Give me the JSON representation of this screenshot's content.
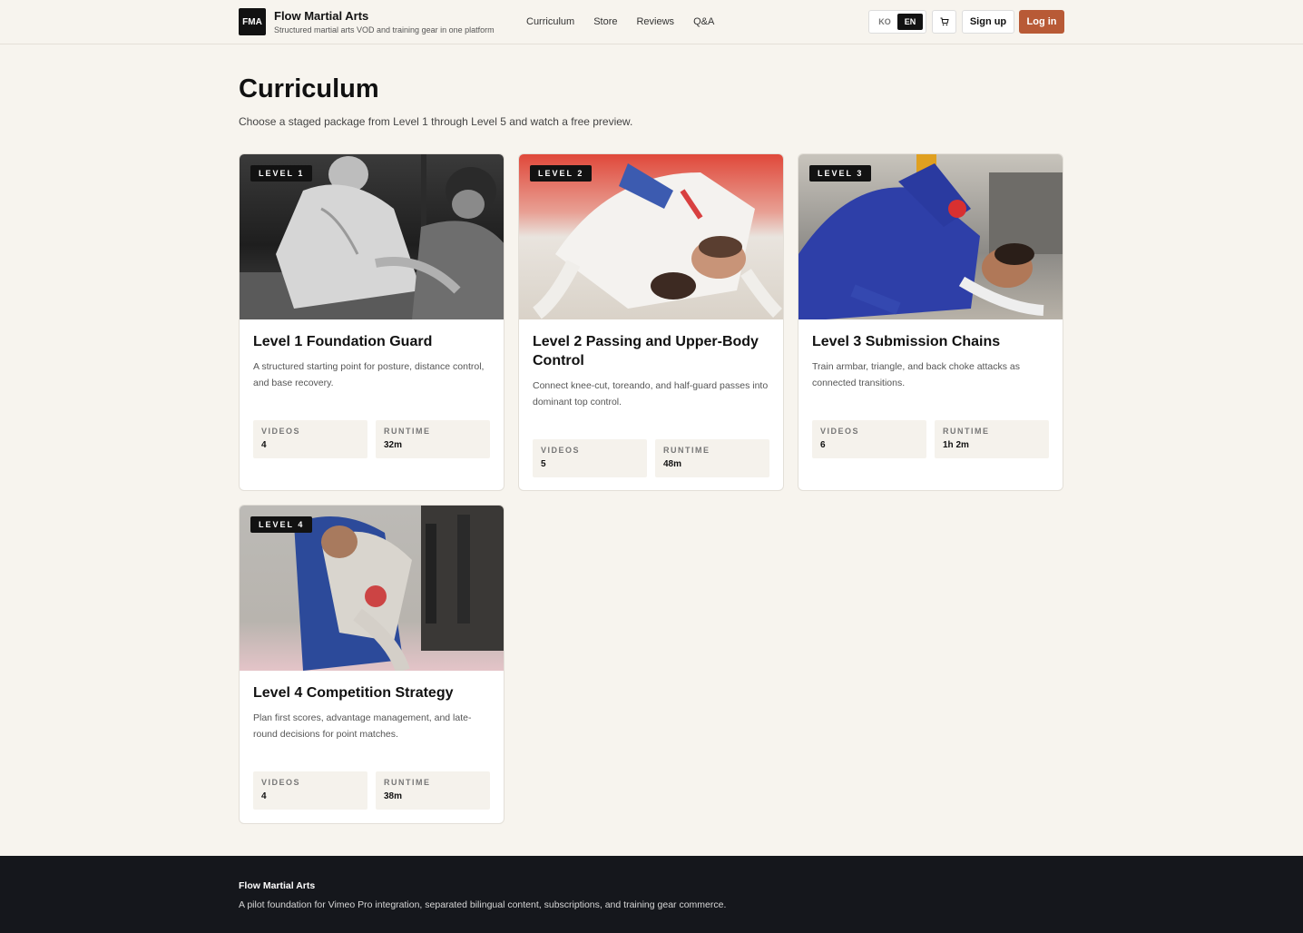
{
  "header": {
    "logo": "FMA",
    "brand_title": "Flow Martial Arts",
    "brand_subtitle": "Structured martial arts VOD and training gear in one platform",
    "nav": [
      "Curriculum",
      "Store",
      "Reviews",
      "Q&A"
    ],
    "lang_ko": "KO",
    "lang_en": "EN",
    "cart_icon": "cart-icon",
    "signup": "Sign up",
    "login": "Log in"
  },
  "main": {
    "title": "Curriculum",
    "subtitle": "Choose a staged package from Level 1 through Level 5 and watch a free preview."
  },
  "cards": [
    {
      "badge": "LEVEL 1",
      "title": "Level 1 Foundation Guard",
      "desc": "A structured starting point for posture, distance control, and base recovery.",
      "videos_label": "VIDEOS",
      "videos": "4",
      "runtime_label": "RUNTIME",
      "runtime": "32m"
    },
    {
      "badge": "LEVEL 2",
      "title": "Level 2 Passing and Upper-Body Control",
      "desc": "Connect knee-cut, toreando, and half-guard passes into dominant top control.",
      "videos_label": "VIDEOS",
      "videos": "5",
      "runtime_label": "RUNTIME",
      "runtime": "48m"
    },
    {
      "badge": "LEVEL 3",
      "title": "Level 3 Submission Chains",
      "desc": "Train armbar, triangle, and back choke attacks as connected transitions.",
      "videos_label": "VIDEOS",
      "videos": "6",
      "runtime_label": "RUNTIME",
      "runtime": "1h 2m"
    },
    {
      "badge": "LEVEL 4",
      "title": "Level 4 Competition Strategy",
      "desc": "Plan first scores, advantage management, and late-round decisions for point matches.",
      "videos_label": "VIDEOS",
      "videos": "4",
      "runtime_label": "RUNTIME",
      "runtime": "38m"
    }
  ],
  "footer": {
    "title": "Flow Martial Arts",
    "text": "A pilot foundation for Vimeo Pro integration, separated bilingual content, subscriptions, and training gear commerce."
  },
  "colors": {
    "background": "#f7f4ee",
    "accent": "#b85a36",
    "dark": "#121212",
    "footer": "#15171c"
  }
}
